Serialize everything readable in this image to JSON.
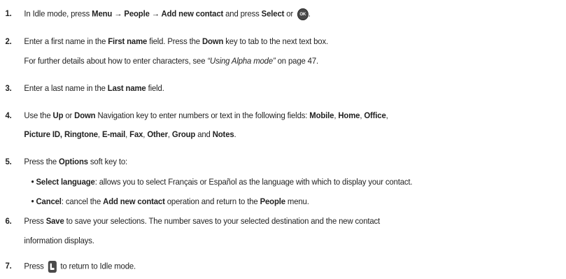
{
  "steps": [
    {
      "num": "1.",
      "parts": [
        "In Idle mode, press ",
        "Menu → People → Add new contact",
        " and press ",
        "Select",
        " or ",
        "."
      ],
      "ok_icon_text": "OK"
    },
    {
      "num": "2.",
      "parts": [
        "Enter a first name in the ",
        "First name",
        " field. Press the ",
        "Down",
        " key to tab to the next text box."
      ]
    },
    {
      "sub": [
        "For further details about how to enter characters, see ",
        "“Using Alpha mode”",
        " on page 47."
      ]
    },
    {
      "num": "3.",
      "parts": [
        "Enter a last name in the ",
        "Last name",
        " field."
      ]
    },
    {
      "num": "4.",
      "parts": [
        "Use the ",
        "Up",
        " or ",
        "Down",
        " Navigation key to enter numbers or text in the following fields: ",
        "Mobile",
        ", ",
        "Home",
        ", ",
        "Office",
        ","
      ]
    },
    {
      "cont": [
        "Picture ID, Ringtone",
        ", ",
        "E-mail",
        ", ",
        "Fax",
        ", ",
        "Other",
        ", ",
        "Group",
        " and ",
        "Notes",
        "."
      ]
    },
    {
      "num": "5.",
      "parts": [
        "Press the ",
        "Options",
        " soft key to:"
      ]
    },
    {
      "bullet": [
        "• ",
        "Select language",
        ": allows you to select Français or Español as the language with which to display your contact."
      ]
    },
    {
      "bullet2": [
        "• ",
        "Cancel",
        ": cancel the ",
        "Add new contact",
        " operation and return to the ",
        "People",
        " menu."
      ]
    },
    {
      "num": "6.",
      "parts": [
        "Press ",
        "Save",
        " to save your selections. The number saves to your selected destination and the new contact"
      ]
    },
    {
      "cont2": "information displays."
    },
    {
      "num": "7.",
      "parts": [
        "Press ",
        " to return to Idle mode."
      ]
    }
  ]
}
